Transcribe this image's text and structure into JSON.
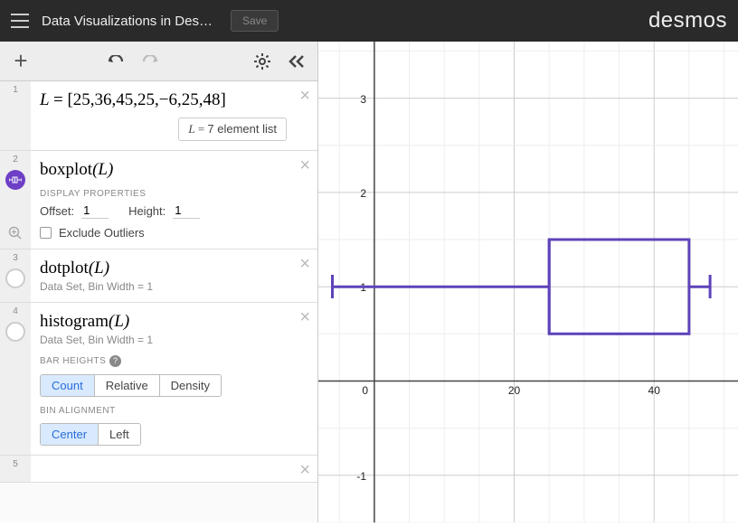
{
  "header": {
    "title": "Data Visualizations in Des…",
    "save_label": "Save",
    "logo": "desmos"
  },
  "toolbar": {
    "add_label": "+",
    "undo_label": "↶",
    "redo_label": "↷"
  },
  "expressions": {
    "row1": {
      "index": "1",
      "math": "L = [25,36,45,25,−6,25,48]",
      "annot_prefix": "L  = ",
      "annot_text": "7 element list"
    },
    "row2": {
      "index": "2",
      "math": "boxplot(L)",
      "props_label": "DISPLAY PROPERTIES",
      "offset_label": "Offset:",
      "offset_value": "1",
      "height_label": "Height:",
      "height_value": "1",
      "exclude_label": "Exclude Outliers"
    },
    "row3": {
      "index": "3",
      "math": "dotplot(L)",
      "subtext": "Data Set, Bin Width = 1"
    },
    "row4": {
      "index": "4",
      "math": "histogram(L)",
      "subtext": "Data Set, Bin Width = 1",
      "bar_heights_label": "BAR HEIGHTS",
      "btn_count": "Count",
      "btn_relative": "Relative",
      "btn_density": "Density",
      "bin_align_label": "BIN ALIGNMENT",
      "btn_center": "Center",
      "btn_left": "Left"
    },
    "row5": {
      "index": "5"
    }
  },
  "chart_data": {
    "type": "boxplot",
    "data": [
      25,
      36,
      45,
      25,
      -6,
      25,
      48
    ],
    "summary": {
      "min": -6,
      "q1": 25,
      "median": 25,
      "q3": 45,
      "max": 48
    },
    "offset": 1,
    "height": 1,
    "x_axis": {
      "visible_ticks": [
        0,
        20,
        40
      ],
      "range": [
        -8,
        52
      ]
    },
    "y_axis": {
      "visible_ticks": [
        -1,
        1,
        2,
        3
      ],
      "range": [
        -1.5,
        3.6
      ]
    },
    "xlabel": "",
    "ylabel": ""
  },
  "axis_labels": {
    "x0": "0",
    "x20": "20",
    "x40": "40",
    "y1": "1",
    "y2": "2",
    "y3": "3",
    "ym1": "-1"
  }
}
